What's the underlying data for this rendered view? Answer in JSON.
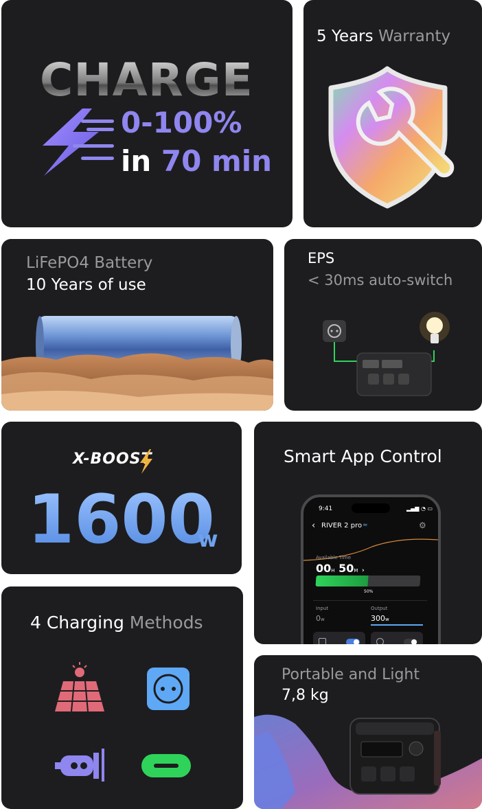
{
  "charge": {
    "title": "CHARGE",
    "range": "0-100%",
    "in_word": "in",
    "time": "70 min"
  },
  "warranty": {
    "years": "5 Years",
    "word": "Warranty"
  },
  "battery": {
    "type": "LiFePO4 Battery",
    "life": "10 Years of use"
  },
  "eps": {
    "title": "EPS",
    "subtitle": "< 30ms auto-switch"
  },
  "xboost": {
    "logo": "X-BOOST",
    "value": "1600",
    "unit": "w"
  },
  "app": {
    "title": "Smart App Control",
    "phone": {
      "clock": "9:41",
      "device": "RIVER 2 pro",
      "available_label": "Available Time",
      "hours": "00",
      "h_unit": "H",
      "minutes": "50",
      "m_unit": "M",
      "battery_level": "50%",
      "input_label": "Input",
      "input_value": "0",
      "input_unit": "w",
      "output_label": "Output",
      "output_value": "300",
      "output_unit": "w"
    }
  },
  "charging": {
    "count": "4 Charging",
    "word": "Methods",
    "icons": [
      "solar-panel-icon",
      "wall-socket-icon",
      "car-charger-icon",
      "usb-c-icon"
    ]
  },
  "portable": {
    "title": "Portable and Light",
    "weight": "7,8 kg"
  },
  "colors": {
    "card": "#1d1d1f",
    "accent_purple": "#8f86ef",
    "green": "#2fd35a",
    "blue": "#5fa8f5",
    "pink": "#e06a78"
  }
}
